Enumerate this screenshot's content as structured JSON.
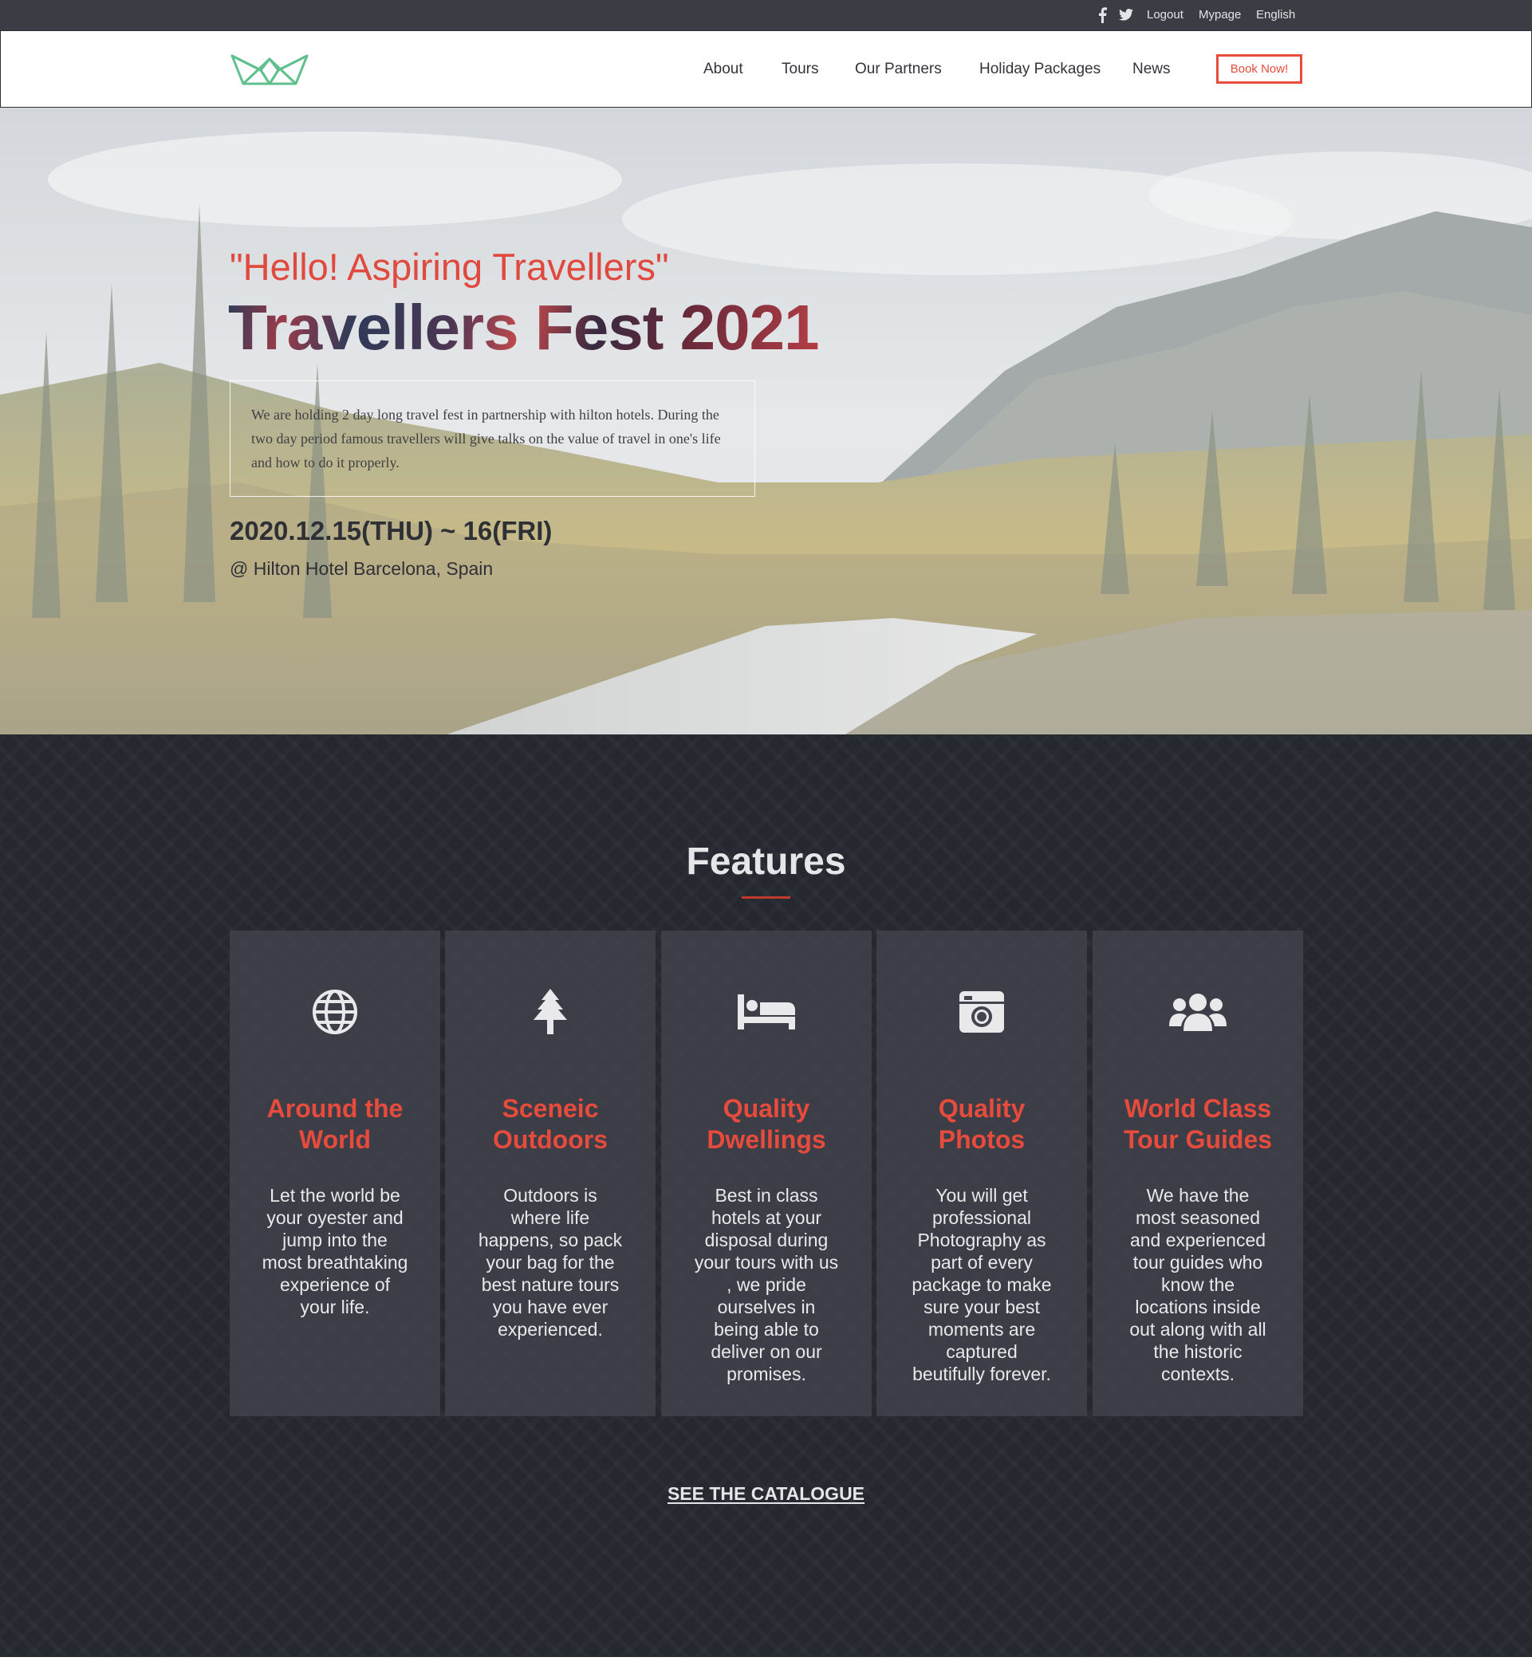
{
  "topbar": {
    "social": [
      "facebook-icon",
      "twitter-icon"
    ],
    "links": {
      "logout": "Logout",
      "mypage": "Mypage",
      "language": "English"
    }
  },
  "nav": {
    "logo": "crown-logo-icon",
    "items": [
      "About",
      "Tours",
      "Our Partners",
      "Holiday Packages",
      "News"
    ],
    "cta": "Book Now!"
  },
  "hero": {
    "greeting": "\"Hello! Aspiring Travellers\"",
    "title": "Travellers Fest 2021",
    "description": "We are holding 2 day long travel fest in partnership with hilton hotels. During the two day period famous travellers will give talks on the value of travel in one's life and how to do it properly.",
    "date": "2020.12.15(THU) ~ 16(FRI)",
    "venue": "@ Hilton Hotel Barcelona, Spain"
  },
  "features": {
    "heading": "Features",
    "cards": [
      {
        "icon": "globe-icon",
        "title": "Around the World",
        "body": "Let the world be your oyester and jump into the most breathtaking experience of your life."
      },
      {
        "icon": "tree-icon",
        "title": "Sceneic Outdoors",
        "body": "Outdoors is where life happens, so pack your bag for the best nature tours you have ever experienced."
      },
      {
        "icon": "bed-icon",
        "title": "Quality Dwellings",
        "body": "Best in class hotels at your disposal during your tours with us , we pride ourselves in being able to deliver on our promises."
      },
      {
        "icon": "camera-icon",
        "title": "Quality Photos",
        "body": "You will get professional Photography as part of every package to make sure your best moments are captured beutifully forever."
      },
      {
        "icon": "users-icon",
        "title": "World Class Tour Guides",
        "body": "We have the most seasoned and experienced tour guides who know the locations inside out along with all the historic contexts."
      }
    ],
    "catalogue_link": "SEE THE CATALOGUE"
  },
  "colors": {
    "accent": "#e74c3c",
    "dark_bg": "#262830",
    "card_bg": "#42444e",
    "topbar_bg": "#3b3d44",
    "logo_green": "#5fc08d"
  }
}
